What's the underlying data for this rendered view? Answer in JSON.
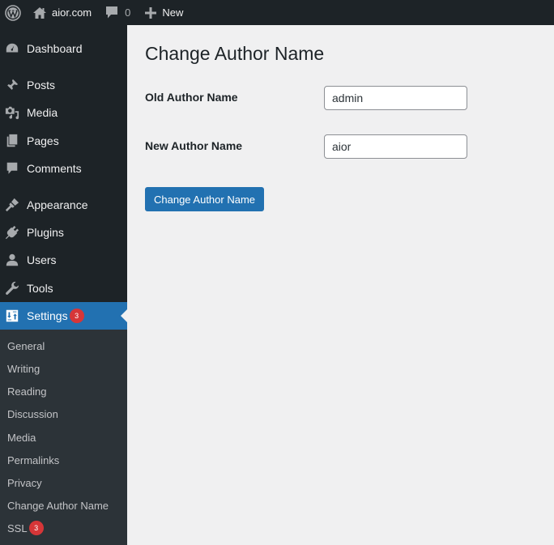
{
  "admin_bar": {
    "wp_logo_icon": "wordpress-logo-icon",
    "site_icon": "home-icon",
    "site_name": "aior.com",
    "comments_icon": "comment-bubble-icon",
    "comments_count": "0",
    "new_icon": "plus-icon",
    "new_label": "New"
  },
  "sidebar": {
    "items": [
      {
        "label": "Dashboard",
        "icon": "dashboard-gauge-icon"
      },
      {
        "label": "Posts",
        "icon": "pushpin-icon"
      },
      {
        "label": "Media",
        "icon": "media-icon"
      },
      {
        "label": "Pages",
        "icon": "pages-icon"
      },
      {
        "label": "Comments",
        "icon": "comment-icon"
      },
      {
        "label": "Appearance",
        "icon": "paintbrush-icon"
      },
      {
        "label": "Plugins",
        "icon": "plug-icon"
      },
      {
        "label": "Users",
        "icon": "user-icon"
      },
      {
        "label": "Tools",
        "icon": "wrench-icon"
      },
      {
        "label": "Settings",
        "icon": "settings-sliders-icon",
        "badge": "3",
        "current": true
      }
    ],
    "submenu": [
      {
        "label": "General"
      },
      {
        "label": "Writing"
      },
      {
        "label": "Reading"
      },
      {
        "label": "Discussion"
      },
      {
        "label": "Media"
      },
      {
        "label": "Permalinks"
      },
      {
        "label": "Privacy"
      },
      {
        "label": "Change Author Name",
        "current": true
      },
      {
        "label": "SSL",
        "badge": "3"
      }
    ]
  },
  "main": {
    "title": "Change Author Name",
    "old_label": "Old Author Name",
    "old_value": "admin",
    "new_label": "New Author Name",
    "new_value": "aior",
    "submit_label": "Change Author Name"
  },
  "colors": {
    "admin_bar_bg": "#1d2327",
    "sidebar_bg": "#1d2327",
    "submenu_bg": "#2c3338",
    "accent": "#2271b1",
    "badge": "#d63638",
    "content_bg": "#f0f0f1"
  }
}
